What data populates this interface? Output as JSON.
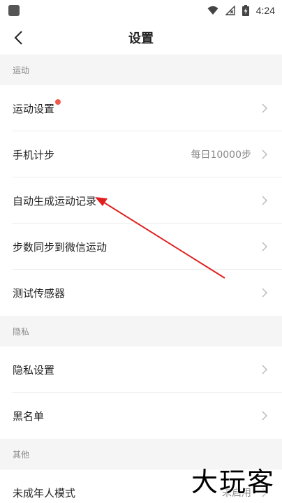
{
  "status_bar": {
    "time": "4:24"
  },
  "header": {
    "title": "设置"
  },
  "sections": [
    {
      "title": "运动",
      "items": [
        {
          "label": "运动设置",
          "value": "",
          "badge": true
        },
        {
          "label": "手机计步",
          "value": "每日10000步",
          "badge": false
        },
        {
          "label": "自动生成运动记录",
          "value": "",
          "badge": false
        },
        {
          "label": "步数同步到微信运动",
          "value": "",
          "badge": false
        },
        {
          "label": "测试传感器",
          "value": "",
          "badge": false
        }
      ]
    },
    {
      "title": "隐私",
      "items": [
        {
          "label": "隐私设置",
          "value": ""
        },
        {
          "label": "黑名单",
          "value": ""
        }
      ]
    },
    {
      "title": "其他",
      "items": [
        {
          "label": "未成年人模式",
          "value": "未启用"
        }
      ]
    }
  ],
  "watermark": "大玩客",
  "colors": {
    "badge": "#f05a4a",
    "annotation_arrow": "#e02020",
    "section_bg": "#f5f5f5"
  }
}
